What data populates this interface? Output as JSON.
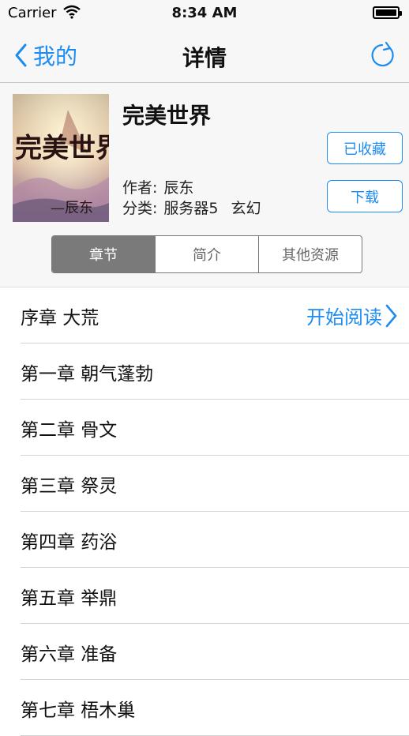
{
  "status": {
    "carrier": "Carrier",
    "time": "8:34 AM",
    "battery_level": 1.0
  },
  "nav": {
    "back_label": "我的",
    "title": "详情"
  },
  "book": {
    "title": "完美世界",
    "author_label": "作者:",
    "author": "辰东",
    "category_label": "分类:",
    "server": "服务器5",
    "genre": "玄幻",
    "cover_text": "完美世界",
    "cover_author": "—辰东"
  },
  "buttons": {
    "favorite": "已收藏",
    "download": "下载"
  },
  "tabs": [
    {
      "label": "章节",
      "active": true
    },
    {
      "label": "简介",
      "active": false
    },
    {
      "label": "其他资源",
      "active": false
    }
  ],
  "start_reading": "开始阅读",
  "chapters": [
    "序章 大荒",
    "第一章 朝气蓬勃",
    "第二章 骨文",
    "第三章 祭灵",
    "第四章 药浴",
    "第五章 举鼎",
    "第六章 准备",
    "第七章 梧木巢"
  ],
  "colors": {
    "accent": "#1d8cf0",
    "segment_active": "#7a7a7a"
  }
}
